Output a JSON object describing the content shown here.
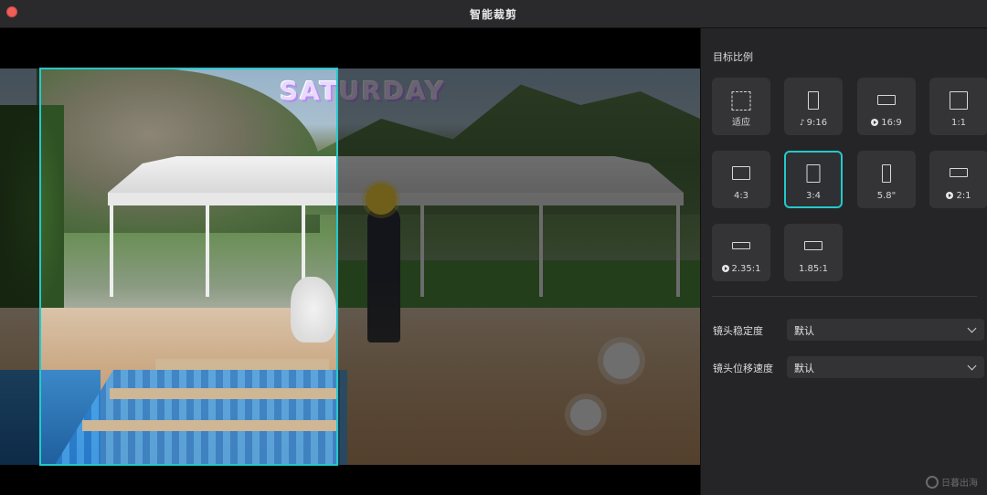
{
  "window": {
    "title": "智能裁剪"
  },
  "preview": {
    "sticker_text": "SATURDAY"
  },
  "sidebar": {
    "target_ratio_label": "目标比例",
    "ratios": [
      {
        "label": "适应",
        "icon": "fit-dashed-icon",
        "platform": ""
      },
      {
        "label": "9:16",
        "icon": "portrait-9-16-icon",
        "platform": "tiktok-icon"
      },
      {
        "label": "16:9",
        "icon": "landscape-16-9-icon",
        "platform": "youtube-play-icon"
      },
      {
        "label": "1:1",
        "icon": "square-1-1-icon",
        "platform": ""
      },
      {
        "label": "4:3",
        "icon": "landscape-4-3-icon",
        "platform": ""
      },
      {
        "label": "3:4",
        "icon": "portrait-3-4-icon",
        "platform": "",
        "selected": true
      },
      {
        "label": "5.8\"",
        "icon": "phone-5-8-icon",
        "platform": ""
      },
      {
        "label": "2:1",
        "icon": "wide-2-1-icon",
        "platform": "youtube-play-icon"
      },
      {
        "label": "2.35:1",
        "icon": "cinema-2-35-1-icon",
        "platform": "youtube-play-icon"
      },
      {
        "label": "1.85:1",
        "icon": "cinema-1-85-1-icon",
        "platform": ""
      }
    ],
    "stabilization": {
      "label": "镜头稳定度",
      "value": "默认"
    },
    "pan_speed": {
      "label": "镜头位移速度",
      "value": "默认"
    }
  },
  "watermark": {
    "text": "日暮出海"
  },
  "colors": {
    "accent": "#25c8cc",
    "close": "#ee5f57",
    "panel": "#252527"
  }
}
